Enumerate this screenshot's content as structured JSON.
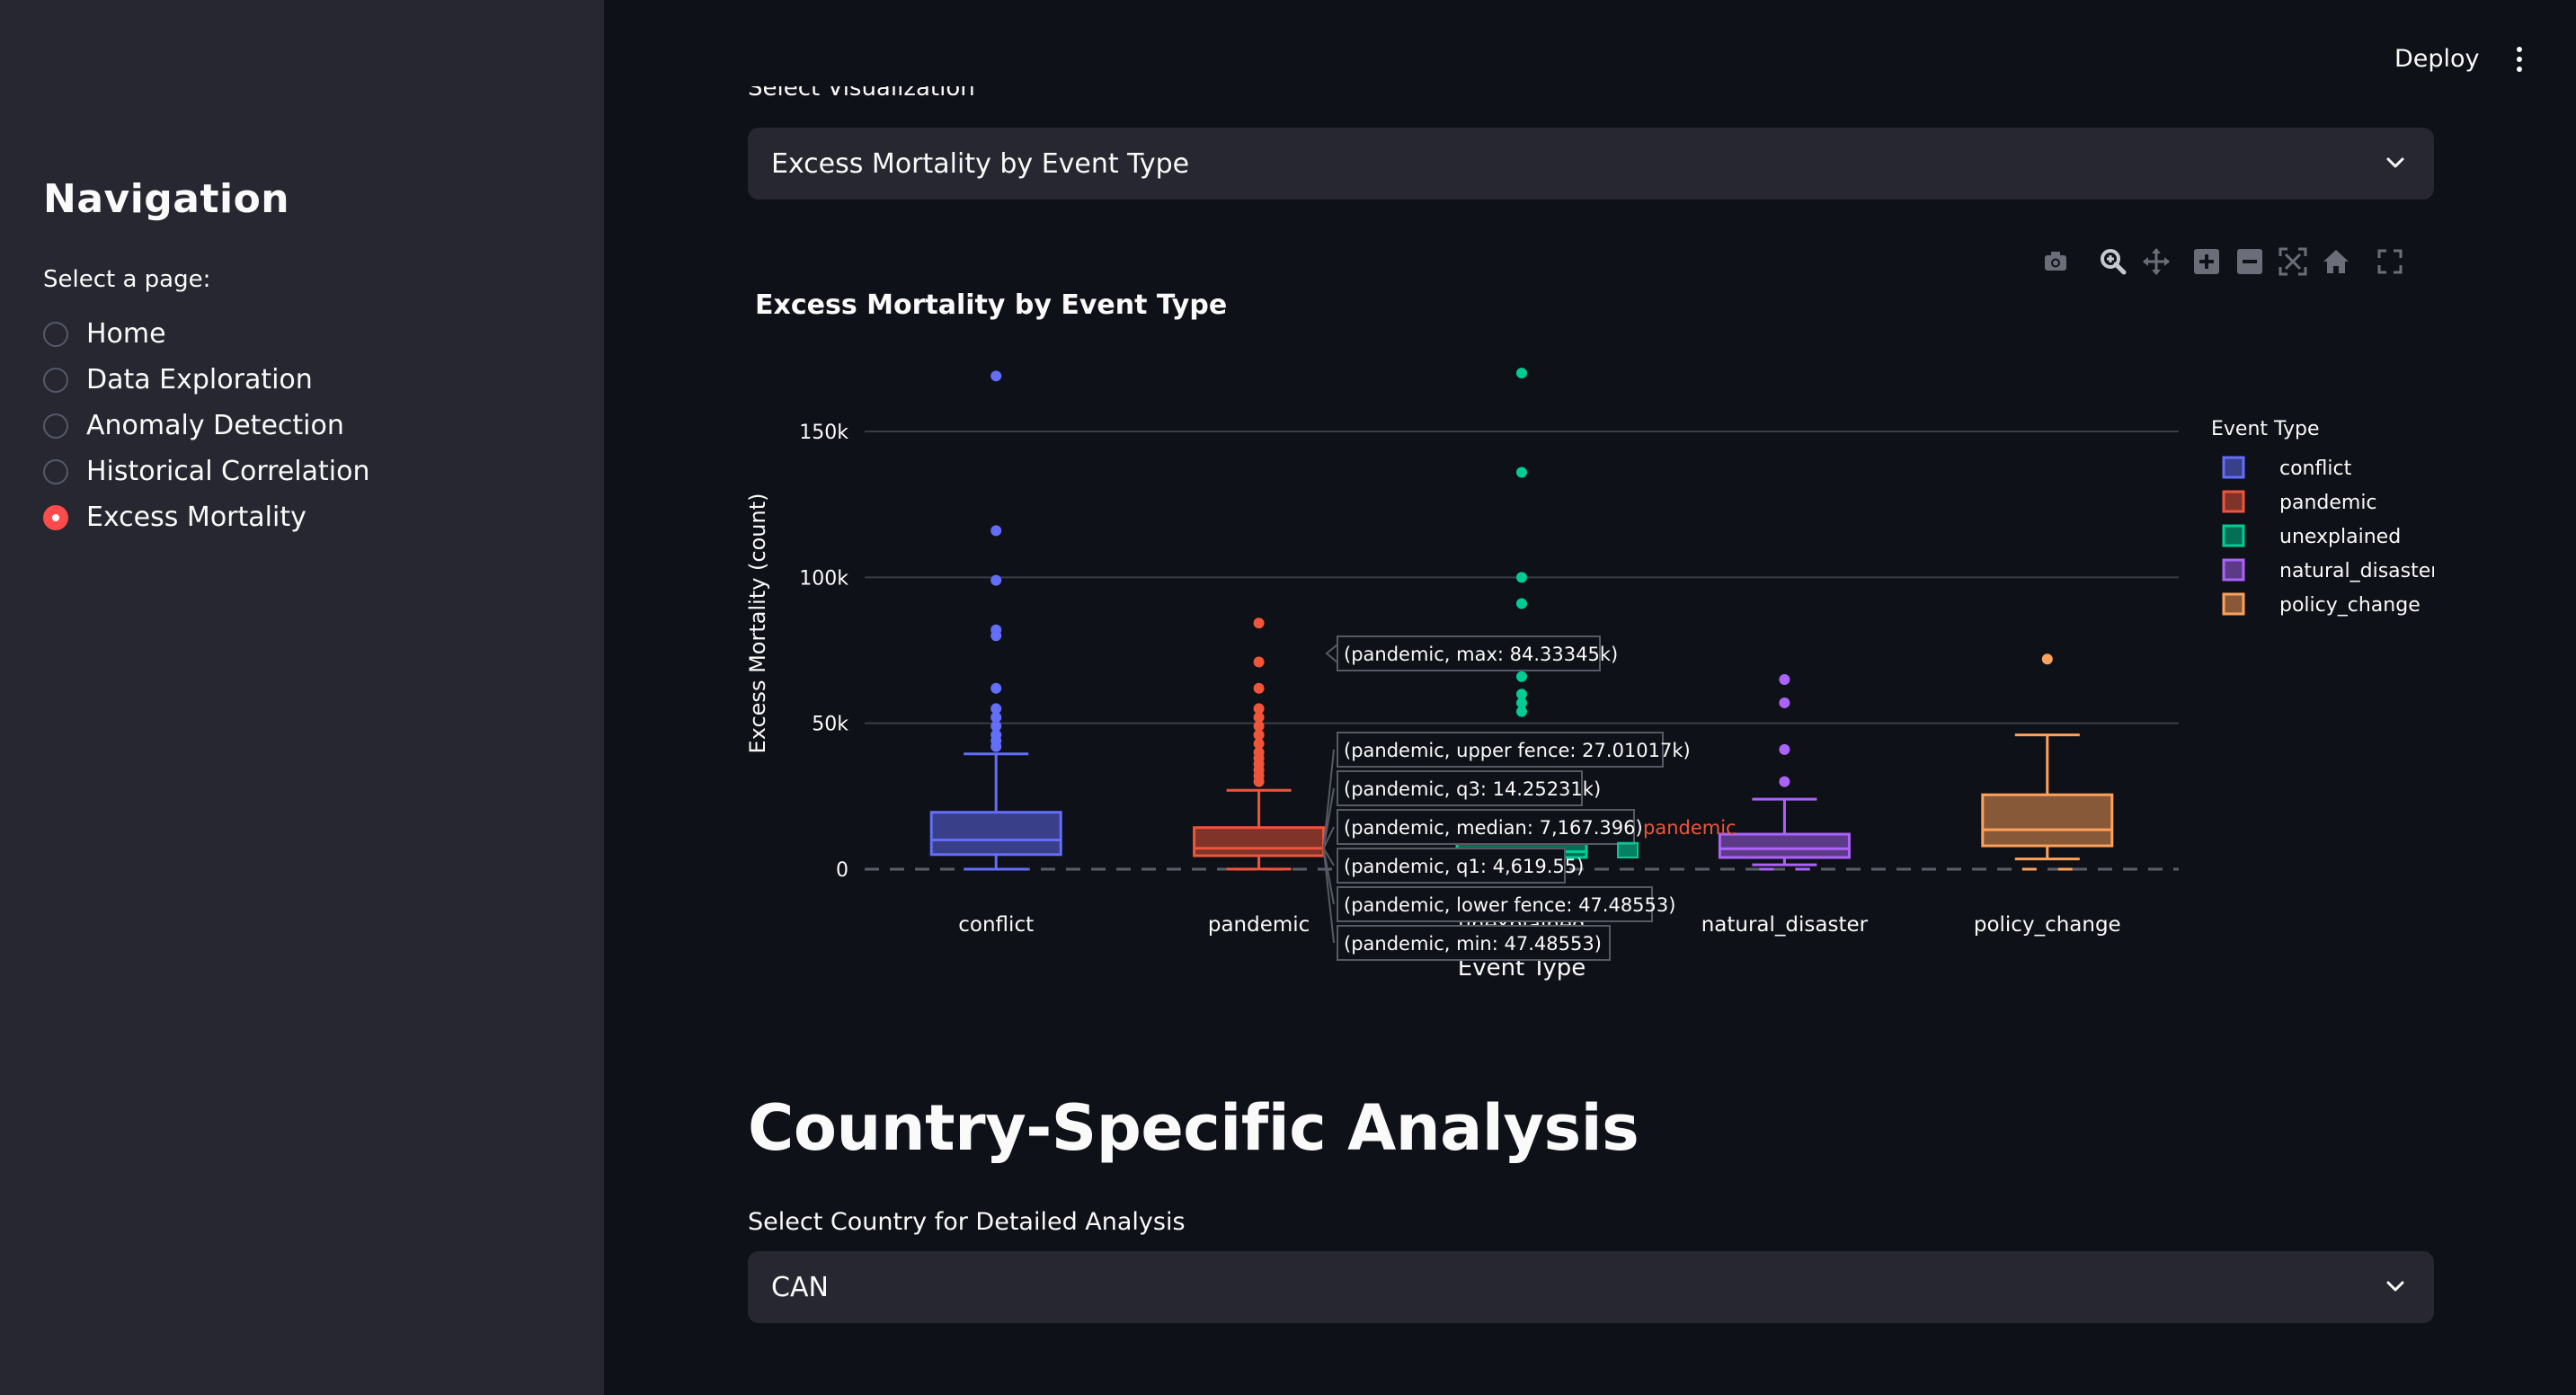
{
  "sidebar": {
    "title": "Navigation",
    "select_label": "Select a page:",
    "items": [
      {
        "label": "Home",
        "selected": false
      },
      {
        "label": "Data Exploration",
        "selected": false
      },
      {
        "label": "Anomaly Detection",
        "selected": false
      },
      {
        "label": "Historical Correlation",
        "selected": false
      },
      {
        "label": "Excess Mortality",
        "selected": true
      }
    ]
  },
  "header": {
    "deploy_label": "Deploy",
    "menu_icon": "kebab-menu-icon"
  },
  "visualization_select": {
    "label": "Select Visualization",
    "value": "Excess Mortality by Event Type"
  },
  "modebar": {
    "icons": [
      "camera-icon",
      "zoom-icon",
      "pan-icon",
      "zoom-in-icon",
      "zoom-out-icon",
      "autoscale-icon",
      "reset-axes-icon",
      "fullscreen-icon"
    ]
  },
  "country_section": {
    "heading": "Country-Specific Analysis",
    "select_label": "Select Country for Detailed Analysis",
    "select_value": "CAN"
  },
  "colors": {
    "conflict": "#636efa",
    "pandemic": "#ef553b",
    "unexplained": "#00cc96",
    "natural_disaster": "#ab63fa",
    "policy_change": "#ffa15a",
    "accent": "#ff4b4b"
  },
  "chart_data": {
    "type": "box",
    "title": "Excess Mortality by Event Type",
    "xlabel": "Event Type",
    "ylabel": "Excess Mortality (count)",
    "ylim": [
      0,
      175000
    ],
    "yticks": [
      0,
      50000,
      100000,
      150000
    ],
    "ytick_labels": [
      "0",
      "50k",
      "100k",
      "150k"
    ],
    "grid": true,
    "legend_title": "Event Type",
    "legend_position": "top-right",
    "categories": [
      "conflict",
      "pandemic",
      "unexplained",
      "natural_disaster",
      "policy_change"
    ],
    "boxes": [
      {
        "name": "conflict",
        "min": 0,
        "lower_fence": 0,
        "q1": 5000,
        "median": 10000,
        "q3": 19500,
        "upper_fence": 39500,
        "outliers": [
          169000,
          116000,
          99000,
          82000,
          80000,
          62000,
          55000,
          52000,
          49000,
          46000,
          44000,
          42000
        ]
      },
      {
        "name": "pandemic",
        "min": 47.48553,
        "lower_fence": 47.48553,
        "q1": 4619.55,
        "median": 7167.396,
        "q3": 14252.31,
        "upper_fence": 27010.17,
        "max": 84333.45,
        "outliers": [
          84333.45,
          71000,
          62000,
          55000,
          52000,
          49000,
          46000,
          43000,
          40000,
          38000,
          36000,
          34000,
          32000,
          30000
        ]
      },
      {
        "name": "unexplained",
        "min": 0,
        "lower_fence": 0,
        "q1": 4000,
        "median": 6000,
        "q3": 9000,
        "upper_fence": 20000,
        "outliers": [
          170000,
          136000,
          100000,
          91000,
          74000,
          72000,
          70000,
          66000,
          60000,
          57000,
          54000
        ]
      },
      {
        "name": "natural_disaster",
        "min": 0,
        "lower_fence": 1500,
        "q1": 4000,
        "median": 7000,
        "q3": 12000,
        "upper_fence": 24000,
        "outliers": [
          65000,
          57000,
          41000,
          30000
        ]
      },
      {
        "name": "policy_change",
        "min": 0,
        "lower_fence": 3500,
        "q1": 8000,
        "median": 13500,
        "q3": 25500,
        "upper_fence": 46000,
        "outliers": [
          72000
        ]
      }
    ],
    "hover": {
      "labels": [
        "(pandemic, max: 84.33345k)",
        "(pandemic, upper fence: 27.01017k)",
        "(pandemic, q3: 14.25231k)",
        "(pandemic, median: 7,167.396)",
        "(pandemic, q1: 4,619.55)",
        "(pandemic, lower fence: 47.48553)",
        "(pandemic, min: 47.48553)"
      ],
      "trace_label": "pandemic"
    }
  }
}
